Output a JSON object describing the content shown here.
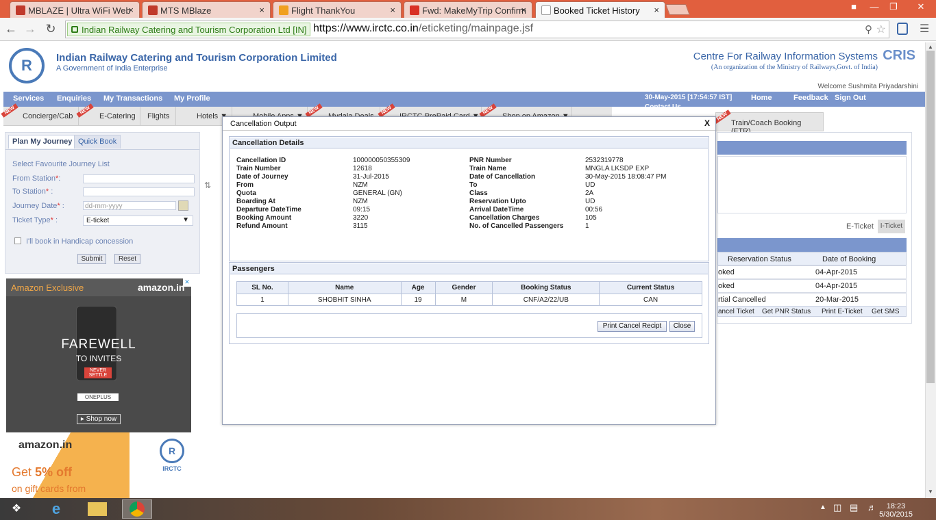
{
  "browser": {
    "tabs": [
      {
        "title": "MBLAZE | Ultra WiFi Web",
        "icon_color": "#c0392b"
      },
      {
        "title": "MTS MBlaze",
        "icon_color": "#c0392b"
      },
      {
        "title": "Flight ThankYou",
        "icon_color": "#f0a020"
      },
      {
        "title": "Fwd: MakeMyTrip Confirm",
        "icon_color": "#d93025"
      },
      {
        "title": "Booked Ticket History",
        "icon_color": "#999999"
      }
    ],
    "ev_label": "Indian Railway Catering and Tourism Corporation Ltd [IN]",
    "url_host": "https://www.irctc.co.in",
    "url_path": "/eticketing/mainpage.jsf"
  },
  "header": {
    "org_name": "Indian Railway Catering and Tourism Corporation Limited",
    "org_sub": "A Government of India Enterprise",
    "cris_title": "Centre For Railway Information Systems",
    "cris_sub": "(An organization of the Ministry of Railways,Govt. of India)",
    "cris_logo": "CRIS",
    "welcome": "Welcome Sushmita Priyadarshini"
  },
  "menu": {
    "items": [
      "Services",
      "Enquiries",
      "My Transactions",
      "My Profile"
    ],
    "datetime": "30-May-2015 [17:54:57 IST]",
    "right_links": [
      "Home",
      "Feedback",
      "Sign Out"
    ],
    "contact": "Contact Us"
  },
  "subnav": {
    "items": [
      "Concierge/Cab",
      "E-Catering",
      "Flights",
      "Hotels ▼",
      "Mobile Apps ▼",
      "Mydala Deals",
      "IRCTC PrePaid Card ▼",
      "Shop on Amazon ▼"
    ],
    "new_label": "NEW",
    "ftr": "Train/Coach Booking (FTR)"
  },
  "journey": {
    "tab_plan": "Plan My Journey",
    "tab_quick": "Quick Book",
    "favourite": "Select Favourite Journey List",
    "from_label": "From Station",
    "to_label": "To Station",
    "date_label": "Journey Date",
    "date_placeholder": "dd-mm-yyyy",
    "ticket_label": "Ticket Type",
    "ticket_value": "E-ticket",
    "handicap": "I'll book in Handicap concession",
    "submit": "Submit",
    "reset": "Reset"
  },
  "ads": {
    "amazon_exclusive": "Amazon Exclusive",
    "amazon_logo": "amazon.in",
    "farewell": "FAREWELL",
    "to_invites": "TO INVITES",
    "never_settle": "NEVER SETTLE",
    "oneplus": "ONEPLUS",
    "shop_now": "▸ Shop now",
    "ad2_logo": "amazon.in",
    "ad2_get": "Get ",
    "ad2_off": "5% off",
    "ad2_on": "on gift cards from",
    "irctc": "IRCTC"
  },
  "background_right": {
    "eticket": "E-Ticket",
    "iticket": "I-Ticket",
    "col_status": "Reservation Status",
    "col_date": "Date of Booking",
    "rows": [
      {
        "status": "oked",
        "date": "04-Apr-2015"
      },
      {
        "status": "oked",
        "date": "04-Apr-2015"
      },
      {
        "status": "rtial Cancelled",
        "date": "20-Mar-2015"
      }
    ],
    "actions": [
      "ancel Ticket",
      "Get PNR Status",
      "Print E-Ticket",
      "Get SMS"
    ]
  },
  "modal": {
    "title": "Cancellation Output",
    "close_x": "X",
    "details_header": "Cancellation Details",
    "details": [
      {
        "k1": "Cancellation ID",
        "v1": "100000050355309",
        "k2": "PNR Number",
        "v2": "2532319778"
      },
      {
        "k1": "Train Number",
        "v1": "12618",
        "k2": "Train Name",
        "v2": "MNGLA LKSDP EXP"
      },
      {
        "k1": "Date of Journey",
        "v1": "31-Jul-2015",
        "k2": "Date of Cancellation",
        "v2": "30-May-2015 18:08:47 PM"
      },
      {
        "k1": "From",
        "v1": "NZM",
        "k2": "To",
        "v2": "UD"
      },
      {
        "k1": "Quota",
        "v1": "GENERAL (GN)",
        "k2": "Class",
        "v2": "2A"
      },
      {
        "k1": "Boarding At",
        "v1": "NZM",
        "k2": "Reservation Upto",
        "v2": "UD"
      },
      {
        "k1": "Departure DateTime",
        "v1": "09:15",
        "k2": "Arrival DateTime",
        "v2": "00:56"
      },
      {
        "k1": "Booking Amount",
        "v1": "3220",
        "k2": "Cancellation Charges",
        "v2": "105"
      },
      {
        "k1": "Refund Amount",
        "v1": "3115",
        "k2": "No. of Cancelled Passengers",
        "v2": "1"
      }
    ],
    "passengers_header": "Passengers",
    "columns": [
      "SL No.",
      "Name",
      "Age",
      "Gender",
      "Booking Status",
      "Current Status"
    ],
    "passengers": [
      {
        "sl": "1",
        "name": "SHOBHIT SINHA",
        "age": "19",
        "gender": "M",
        "booking": "CNF/A2/22/UB",
        "current": "CAN"
      }
    ],
    "print_button": "Print Cancel Recipt",
    "close_button": "Close"
  },
  "taskbar": {
    "time": "18:23",
    "date": "5/30/2015"
  }
}
